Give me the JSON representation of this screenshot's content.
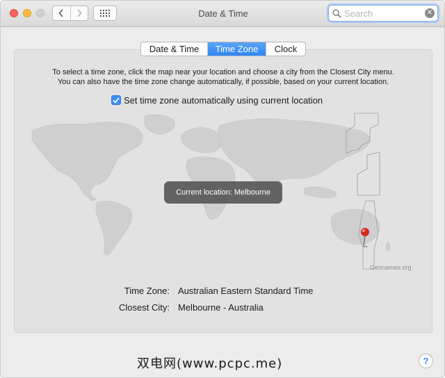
{
  "window": {
    "title": "Date & Time"
  },
  "toolbar": {
    "back_icon": "chevron-left-icon",
    "forward_icon": "chevron-right-icon",
    "grid_icon": "grid-icon"
  },
  "search": {
    "placeholder": "Search",
    "value": ""
  },
  "tabs": [
    {
      "label": "Date & Time",
      "active": false
    },
    {
      "label": "Time Zone",
      "active": true
    },
    {
      "label": "Clock",
      "active": false
    }
  ],
  "description": {
    "line1": "To select a time zone, click the map near your location and choose a city from the Closest City menu.",
    "line2": "You can also have the time zone change automatically, if possible, based on your current location."
  },
  "auto_timezone": {
    "checked": true,
    "label": "Set time zone automatically using current location"
  },
  "map": {
    "tooltip": "Current location: Melbourne",
    "credit": "Geonames.org",
    "pin_color": "#d42b1e"
  },
  "timezone_info": {
    "time_zone_label": "Time Zone:",
    "time_zone_value": "Australian Eastern Standard Time",
    "closest_city_label": "Closest City:",
    "closest_city_value": "Melbourne - Australia"
  },
  "watermark": "双电网(www.pcpc.me)",
  "help": {
    "label": "?"
  },
  "colors": {
    "accent": "#3b8ff3",
    "close": "#fc605c",
    "minimize": "#fdbc40",
    "zoom_disabled": "#d1d1d1"
  }
}
